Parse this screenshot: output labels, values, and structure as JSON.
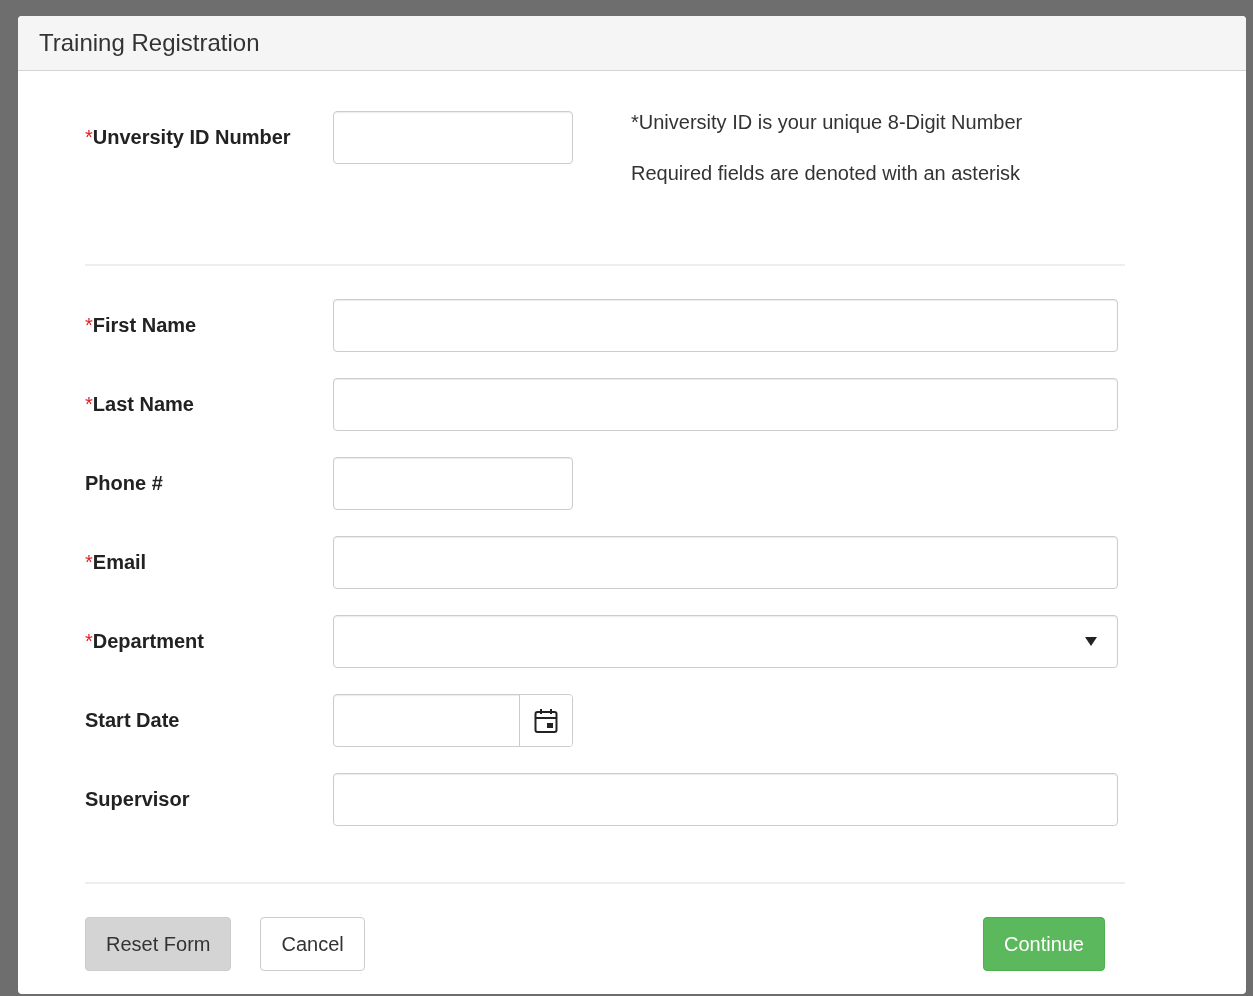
{
  "dialog": {
    "title": "Training Registration"
  },
  "id_field": {
    "label": "Unversity ID Number",
    "required_mark": "*"
  },
  "notes": [
    "*University ID is your unique 8-Digit Number",
    "Required fields are denoted with an asterisk"
  ],
  "fields": [
    {
      "label": "First Name",
      "required_mark": "*",
      "kind": "text"
    },
    {
      "label": "Last Name",
      "required_mark": "*",
      "kind": "text"
    },
    {
      "label": "Phone #",
      "kind": "short"
    },
    {
      "label": "Email",
      "required_mark": "*",
      "kind": "text"
    },
    {
      "label": "Department",
      "required_mark": "*",
      "kind": "select"
    },
    {
      "label": "Start Date",
      "kind": "date"
    },
    {
      "label": "Supervisor",
      "kind": "text"
    }
  ],
  "buttons": [
    {
      "label": "Reset Form",
      "kind": "secondary"
    },
    {
      "label": "Cancel",
      "kind": "plain"
    },
    {
      "label": "Continue",
      "kind": "primary"
    }
  ]
}
